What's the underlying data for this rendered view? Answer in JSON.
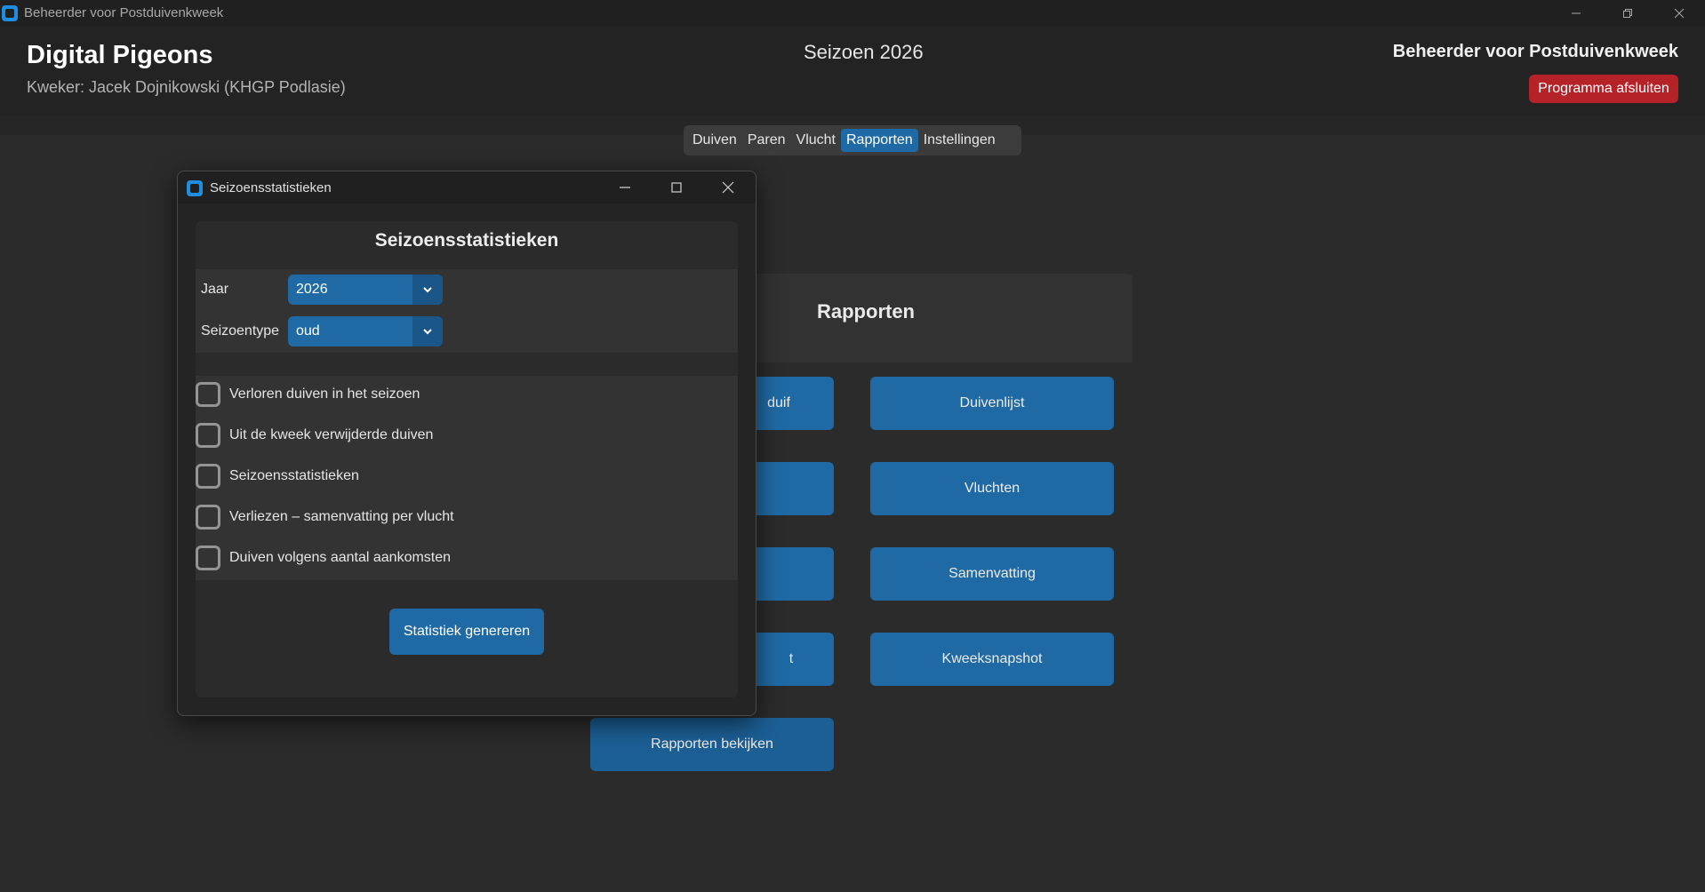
{
  "window": {
    "title": "Beheerder voor Postduivenkweek",
    "controls": [
      "minimize-icon",
      "restore-icon",
      "close-icon"
    ]
  },
  "header": {
    "app_name": "Digital Pigeons",
    "breeder": "Kweker: Jacek Dojnikowski (KHGP Podlasie)",
    "season": "Seizoen 2026",
    "subtitle": "Beheerder voor Postduivenkweek",
    "exit_label": "Programma afsluiten"
  },
  "tabs": [
    {
      "label": "Duiven",
      "active": false
    },
    {
      "label": "Paren",
      "active": false
    },
    {
      "label": "Vlucht",
      "active": false
    },
    {
      "label": "Rapporten",
      "active": true
    },
    {
      "label": "Instellingen",
      "active": false
    }
  ],
  "reports": {
    "title": "Rapporten",
    "buttons": {
      "duif": "duif",
      "duivenlijst": "Duivenlijst",
      "vluchten": "Vluchten",
      "samenvatting": "Samenvatting",
      "partial_t": "t",
      "kweeksnapshot": "Kweeksnapshot",
      "bekijken": "Rapporten bekijken"
    }
  },
  "dialog": {
    "title": "Seizoensstatistieken",
    "heading": "Seizoensstatistieken",
    "year_label": "Jaar",
    "year_value": "2026",
    "season_type_label": "Seizoentype",
    "season_type_value": "oud",
    "options": [
      {
        "label": "Verloren duiven in het seizoen",
        "checked": false
      },
      {
        "label": "Uit de kweek verwijderde duiven",
        "checked": false
      },
      {
        "label": "Seizoensstatistieken",
        "checked": false
      },
      {
        "label": "Verliezen – samenvatting per vlucht",
        "checked": false
      },
      {
        "label": "Duiven volgens aantal aankomsten",
        "checked": false
      }
    ],
    "generate_label": "Statistiek genereren"
  },
  "colors": {
    "accent": "#1f6aa5",
    "danger": "#b52228",
    "background": "#2b2b2b"
  }
}
